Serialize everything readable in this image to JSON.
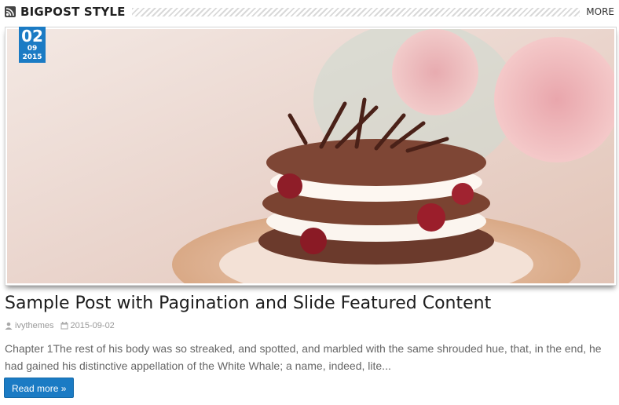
{
  "section": {
    "title": "BIGPOST STYLE",
    "more_label": "MORE",
    "icon": "rss-icon"
  },
  "post": {
    "date_badge": {
      "day": "02",
      "month": "09",
      "year": "2015"
    },
    "title": "Sample Post with Pagination and Slide Featured Content",
    "author": "ivythemes",
    "date": "2015-09-02",
    "excerpt": "Chapter 1The rest of his body was so streaked, and spotted, and marbled with the same shrouded hue, that, in the end, he had gained his distinctive appellation of the White Whale; a name, indeed, lite...",
    "read_more_label": "Read more »"
  },
  "colors": {
    "accent": "#1b7bc4",
    "text": "#1d1d1d",
    "muted": "#999999"
  }
}
